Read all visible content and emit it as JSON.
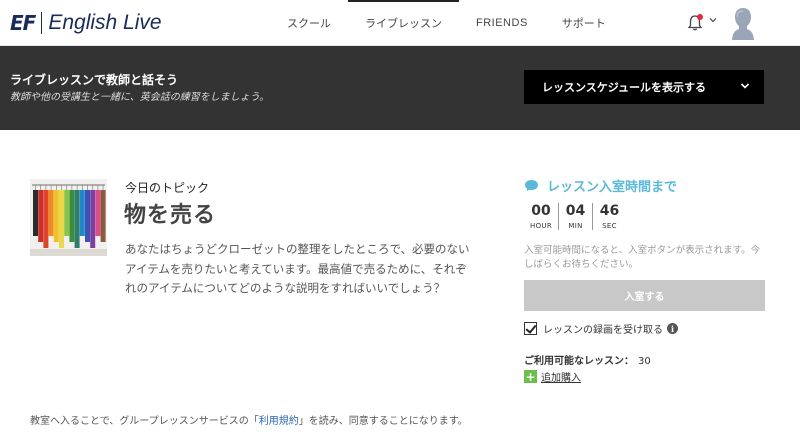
{
  "header": {
    "logo_mark": "EF",
    "logo_text": "English Live",
    "nav": [
      {
        "label": "スクール",
        "active": false
      },
      {
        "label": "ライブレッスン",
        "active": true
      },
      {
        "label": "FRIENDS",
        "active": false
      },
      {
        "label": "サポート",
        "active": false
      }
    ],
    "notification_dot_color": "#e0283a"
  },
  "banner": {
    "title": "ライブレッスンで教師と話そう",
    "subtitle": "教師や他の受講生と一緒に、英会話の練習をしましょう。",
    "schedule_button": "レッスンスケジュールを表示する",
    "background": "#333333"
  },
  "topic": {
    "label": "今日のトピック",
    "title": "物を売る",
    "description": "あなたはちょうどクローゼットの整理をしたところで、必要のないアイテムを売りたいと考えています。最高値で売るために、それぞれのアイテムについてどのような説明をすればいいでしょう？",
    "image_icon": "clothes-rack-photo"
  },
  "countdown": {
    "title": "レッスン入室時間まで",
    "accent": "#5bb8d8",
    "hours": "00",
    "hours_label": "HOUR",
    "minutes": "04",
    "minutes_label": "MIN",
    "seconds": "46",
    "seconds_label": "SEC",
    "note": "入室可能時間になると、入室ボタンが表示されます。今しばらくお待ちください。",
    "enter_button": "入室する",
    "record_label": "レッスンの録画を受け取る",
    "record_checked": true,
    "available_label": "ご利用可能なレッスン：",
    "available_count": "30",
    "purchase_label": "追加購入"
  },
  "footer": {
    "terms_prefix": "教室へ入ることで、グループレッスンサービスの「",
    "terms_link": "利用規約",
    "terms_suffix": "」を読み、同意することになります。"
  }
}
